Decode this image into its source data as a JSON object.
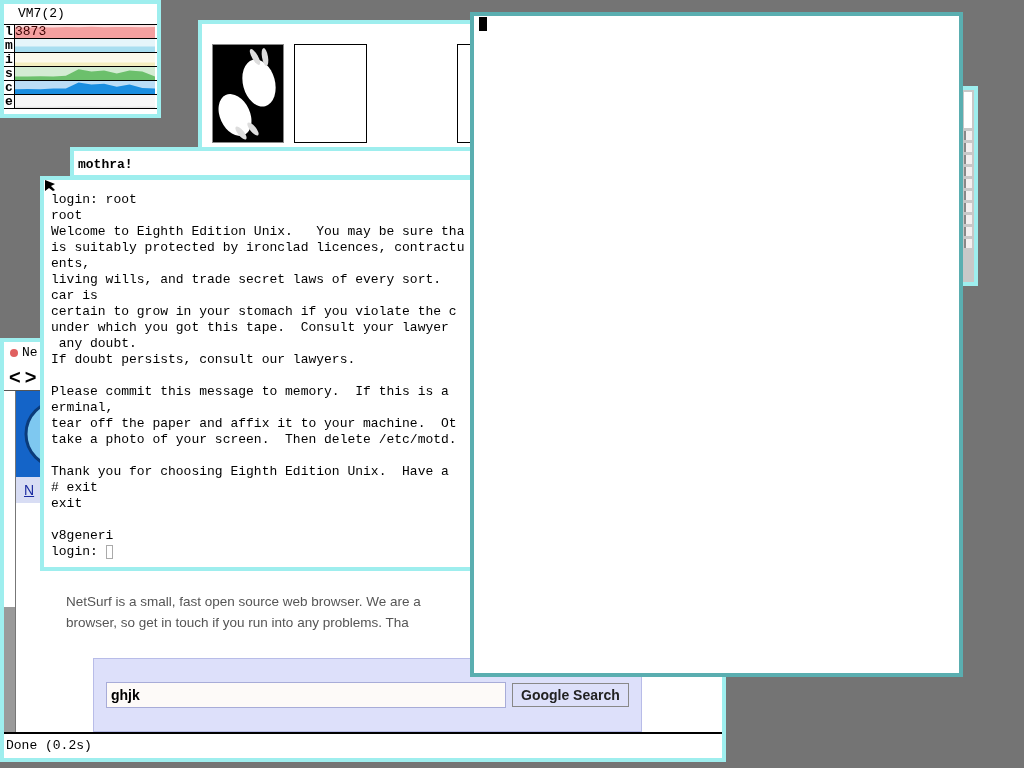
{
  "stats_window": {
    "title": "VM7(2)",
    "rows": [
      {
        "label": "l",
        "color": "#f4a0a0",
        "reading": "3873"
      },
      {
        "label": "m",
        "color": "#a8def0"
      },
      {
        "label": "i",
        "color": "#f4eec0"
      },
      {
        "label": "s",
        "color": "#6cc06c"
      },
      {
        "label": "c",
        "color": "#1a8ee0"
      },
      {
        "label": "e",
        "color": "#e4e4e4"
      }
    ]
  },
  "image_window": {
    "thumbnails": [
      {
        "kind": "picture"
      },
      {
        "kind": "blank"
      },
      {
        "kind": "blank"
      }
    ]
  },
  "mothra_window": {
    "text": "mothra!"
  },
  "terminal": {
    "paragraphs": [
      [
        "login: root",
        "root",
        "Welcome to Eighth Edition Unix.   You may be sure tha",
        "is suitably protected by ironclad licences, contractu",
        "ents,",
        "living wills, and trade secret laws of every sort.",
        "car is",
        "certain to grow in your stomach if you violate the c",
        "under which you got this tape.  Consult your lawyer",
        " any doubt.",
        "If doubt persists, consult our lawyers."
      ],
      [
        "Please commit this message to memory.  If this is a",
        "erminal,",
        "tear off the paper and affix it to your machine.  Ot",
        "take a photo of your screen.  Then delete /etc/motd."
      ],
      [
        "Thank you for choosing Eighth Edition Unix.  Have a",
        "# exit",
        "exit"
      ],
      [
        "v8generi",
        "login: "
      ]
    ]
  },
  "browser": {
    "title": "Ne",
    "nav": [
      "<",
      ">"
    ],
    "link": "N",
    "paragraph_lines": [
      "NetSurf is a small, fast open source web browser. We are a",
      "browser, so get in touch if you run into any problems. Tha"
    ],
    "search": {
      "value": "ghjk",
      "button": "Google Search"
    },
    "status": "Done (0.2s)"
  }
}
